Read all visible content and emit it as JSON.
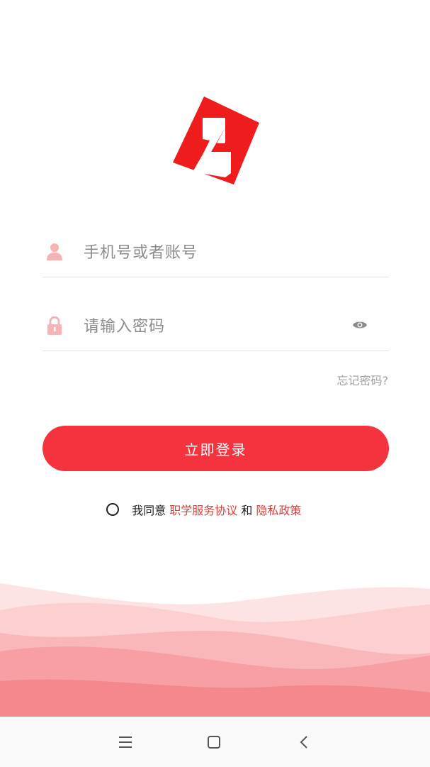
{
  "app": {
    "logo_letter": "Z",
    "brand_color": "#f5333f"
  },
  "form": {
    "account_placeholder": "手机号或者账号",
    "password_placeholder": "请输入密码",
    "forgot_password": "忘记密码?",
    "login_button": "立即登录"
  },
  "agreement": {
    "prefix": "我同意",
    "terms_link": "职学服务协议",
    "conjunction": "和",
    "privacy_link": "隐私政策",
    "checked": false
  },
  "icons": {
    "account": "user-icon",
    "password": "lock-icon",
    "toggle_visibility": "eye-icon"
  },
  "system_nav": {
    "menu": "menu-icon",
    "home": "home-icon",
    "back": "back-icon"
  }
}
